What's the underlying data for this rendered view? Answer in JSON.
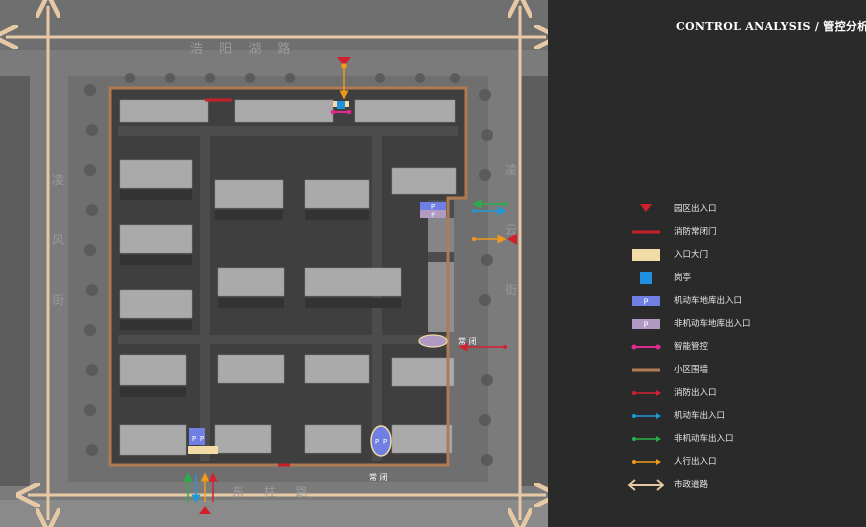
{
  "header": {
    "title": "CONTROL ANALYSIS / 管控分析"
  },
  "map": {
    "roads": {
      "north": "浩 阳 湖 路",
      "south": "东 柱 路",
      "east": "凌 云 街",
      "west": "凌 风 街"
    },
    "labels": {
      "normally_closed": "常 闭",
      "parking": "P"
    }
  },
  "legend": [
    {
      "icon": "red-triangle-icon",
      "label": "园区出入口",
      "color": "#d01f2a"
    },
    {
      "icon": "red-line-icon",
      "label": "消防常闭门",
      "color": "#c8202b"
    },
    {
      "icon": "beige-rect-icon",
      "label": "入口大门",
      "color": "#f1dba6"
    },
    {
      "icon": "blue-square-icon",
      "label": "岗亭",
      "color": "#1f8fe0"
    },
    {
      "icon": "blue-parking-icon",
      "label": "机动车地库出入口",
      "color": "#6f7fe4"
    },
    {
      "icon": "purple-parking-icon",
      "label": "非机动车地库出入口",
      "color": "#b09ac4"
    },
    {
      "icon": "magenta-dot-line-icon",
      "label": "智能管控",
      "color": "#e02a8e"
    },
    {
      "icon": "brown-line-icon",
      "label": "小区围墙",
      "color": "#b07a52"
    },
    {
      "icon": "red-arrow-icon",
      "label": "消防出入口",
      "color": "#d42030"
    },
    {
      "icon": "blue-arrow-icon",
      "label": "机动车出入口",
      "color": "#1e9ad8"
    },
    {
      "icon": "green-arrow-icon",
      "label": "非机动车出入口",
      "color": "#27b04a"
    },
    {
      "icon": "orange-arrow-icon",
      "label": "人行出入口",
      "color": "#f09a1a"
    },
    {
      "icon": "double-arrow-icon",
      "label": "市政道路",
      "color": "#e8c9a6"
    }
  ]
}
